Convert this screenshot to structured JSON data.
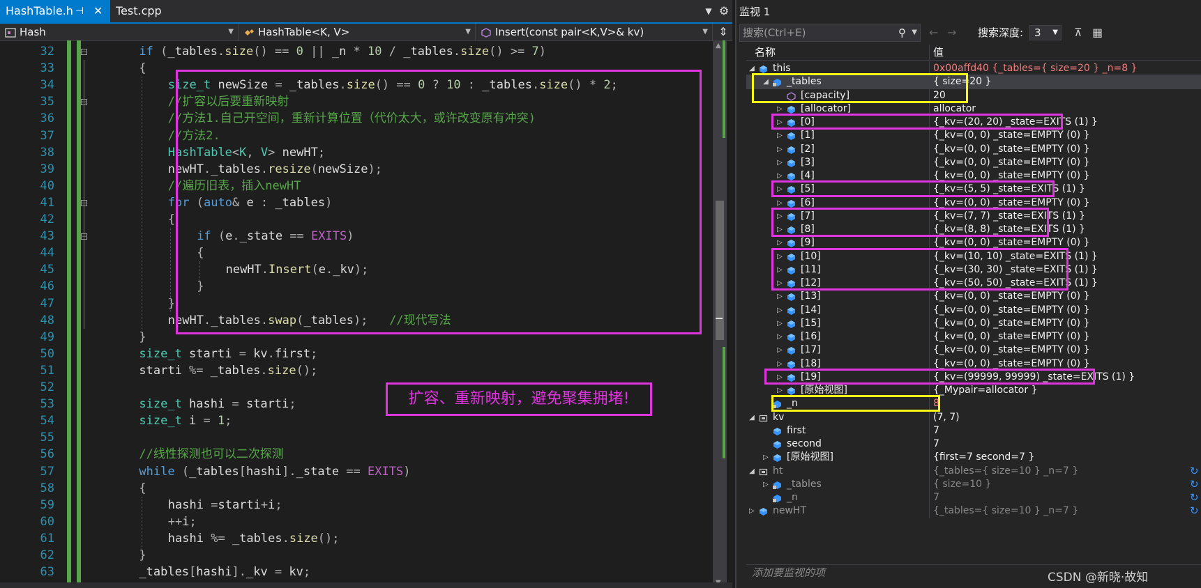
{
  "editor": {
    "tabs": [
      {
        "label": "HashTable.h",
        "pin": "⊣",
        "close": "✕"
      },
      {
        "label": "Test.cpp"
      }
    ],
    "tab_overflow": "▼",
    "tab_settings": "⚙",
    "nav": {
      "scope": "Hash",
      "class": "HashTable<K, V>",
      "member": "Insert(const pair<K,V>& kv)",
      "split": "⇕"
    },
    "line_numbers": [
      "32",
      "33",
      "34",
      "35",
      "36",
      "37",
      "38",
      "39",
      "40",
      "41",
      "42",
      "43",
      "44",
      "45",
      "46",
      "47",
      "48",
      "49",
      "50",
      "51",
      "52",
      "53",
      "54",
      "55",
      "56",
      "57",
      "58",
      "59",
      "60",
      "61",
      "62",
      "63"
    ],
    "callout": "扩容、重新映射，避免聚集拥堵!"
  },
  "watch": {
    "title": "监视 1",
    "search_placeholder": "搜索(Ctrl+E)",
    "search_icon": "search-icon",
    "depth_label": "搜索深度:",
    "depth_value": "3",
    "col_name": "名称",
    "col_value": "值",
    "add_watch": "添加要监视的项",
    "rows": [
      {
        "name": "this",
        "value": "0x00affd40 {_tables={ size=20 } _n=8 }",
        "changed": true,
        "expand": "◢",
        "indent": 0,
        "icon": "field"
      },
      {
        "name": "_tables",
        "value": "{ size=20 }",
        "expand": "◢",
        "indent": 1,
        "icon": "private-field",
        "sel": true
      },
      {
        "name": "[capacity]",
        "value": "20",
        "expand": "",
        "indent": 2,
        "icon": "cube"
      },
      {
        "name": "[allocator]",
        "value": "allocator",
        "expand": "▷",
        "indent": 2,
        "icon": "field"
      },
      {
        "name": "[0]",
        "value": "{_kv=(20, 20) _state=EXITS (1) }",
        "expand": "▷",
        "indent": 2,
        "icon": "field"
      },
      {
        "name": "[1]",
        "value": "{_kv=(0, 0) _state=EMPTY (0) }",
        "expand": "▷",
        "indent": 2,
        "icon": "field"
      },
      {
        "name": "[2]",
        "value": "{_kv=(0, 0) _state=EMPTY (0) }",
        "expand": "▷",
        "indent": 2,
        "icon": "field"
      },
      {
        "name": "[3]",
        "value": "{_kv=(0, 0) _state=EMPTY (0) }",
        "expand": "▷",
        "indent": 2,
        "icon": "field"
      },
      {
        "name": "[4]",
        "value": "{_kv=(0, 0) _state=EMPTY (0) }",
        "expand": "▷",
        "indent": 2,
        "icon": "field"
      },
      {
        "name": "[5]",
        "value": "{_kv=(5, 5) _state=EXITS (1) }",
        "expand": "▷",
        "indent": 2,
        "icon": "field"
      },
      {
        "name": "[6]",
        "value": "{_kv=(0, 0) _state=EMPTY (0) }",
        "expand": "▷",
        "indent": 2,
        "icon": "field"
      },
      {
        "name": "[7]",
        "value": "{_kv=(7, 7) _state=EXITS (1) }",
        "expand": "▷",
        "indent": 2,
        "icon": "field"
      },
      {
        "name": "[8]",
        "value": "{_kv=(8, 8) _state=EXITS (1) }",
        "expand": "▷",
        "indent": 2,
        "icon": "field"
      },
      {
        "name": "[9]",
        "value": "{_kv=(0, 0) _state=EMPTY (0) }",
        "expand": "▷",
        "indent": 2,
        "icon": "field"
      },
      {
        "name": "[10]",
        "value": "{_kv=(10, 10) _state=EXITS (1) }",
        "expand": "▷",
        "indent": 2,
        "icon": "field"
      },
      {
        "name": "[11]",
        "value": "{_kv=(30, 30) _state=EXITS (1) }",
        "expand": "▷",
        "indent": 2,
        "icon": "field"
      },
      {
        "name": "[12]",
        "value": "{_kv=(50, 50) _state=EXITS (1) }",
        "expand": "▷",
        "indent": 2,
        "icon": "field"
      },
      {
        "name": "[13]",
        "value": "{_kv=(0, 0) _state=EMPTY (0) }",
        "expand": "▷",
        "indent": 2,
        "icon": "field"
      },
      {
        "name": "[14]",
        "value": "{_kv=(0, 0) _state=EMPTY (0) }",
        "expand": "▷",
        "indent": 2,
        "icon": "field"
      },
      {
        "name": "[15]",
        "value": "{_kv=(0, 0) _state=EMPTY (0) }",
        "expand": "▷",
        "indent": 2,
        "icon": "field"
      },
      {
        "name": "[16]",
        "value": "{_kv=(0, 0) _state=EMPTY (0) }",
        "expand": "▷",
        "indent": 2,
        "icon": "field"
      },
      {
        "name": "[17]",
        "value": "{_kv=(0, 0) _state=EMPTY (0) }",
        "expand": "▷",
        "indent": 2,
        "icon": "field"
      },
      {
        "name": "[18]",
        "value": "{_kv=(0, 0) _state=EMPTY (0) }",
        "expand": "▷",
        "indent": 2,
        "icon": "field"
      },
      {
        "name": "[19]",
        "value": "{_kv=(99999, 99999) _state=EXITS (1) }",
        "expand": "▷",
        "indent": 2,
        "icon": "field"
      },
      {
        "name": "[原始视图]",
        "value": "{_Mypair=allocator }",
        "expand": "▷",
        "indent": 2,
        "icon": "field"
      },
      {
        "name": "_n",
        "value": "8",
        "changed": true,
        "expand": "",
        "indent": 1,
        "icon": "private-field"
      },
      {
        "name": "kv",
        "value": "(7, 7)",
        "expand": "◢",
        "indent": 0,
        "icon": "local"
      },
      {
        "name": "first",
        "value": "7",
        "expand": "",
        "indent": 1,
        "icon": "field"
      },
      {
        "name": "second",
        "value": "7",
        "expand": "",
        "indent": 1,
        "icon": "field"
      },
      {
        "name": "[原始视图]",
        "value": "{first=7 second=7 }",
        "expand": "▷",
        "indent": 1,
        "icon": "field"
      },
      {
        "name": "ht",
        "value": "{_tables={ size=10 } _n=7 }",
        "dim": true,
        "expand": "◢",
        "indent": 0,
        "icon": "local",
        "refresh": true
      },
      {
        "name": "_tables",
        "value": "{ size=10 }",
        "dim": true,
        "expand": "▷",
        "indent": 1,
        "icon": "private-field",
        "refresh": true
      },
      {
        "name": "_n",
        "value": "7",
        "dim": true,
        "expand": "",
        "indent": 1,
        "icon": "private-field",
        "refresh": true
      },
      {
        "name": "newHT",
        "value": "{_tables={ size=10 } _n=7 }",
        "dim": true,
        "expand": "▷",
        "indent": 0,
        "icon": "field",
        "refresh": true
      }
    ],
    "refresh_glyph": "↻"
  },
  "watermark": "CSDN @新晓·故知",
  "colors": {
    "accent": "#007acc",
    "highlight_magenta": "#e034e0",
    "highlight_yellow": "#f5f518",
    "changed_value": "#f47c7c"
  }
}
